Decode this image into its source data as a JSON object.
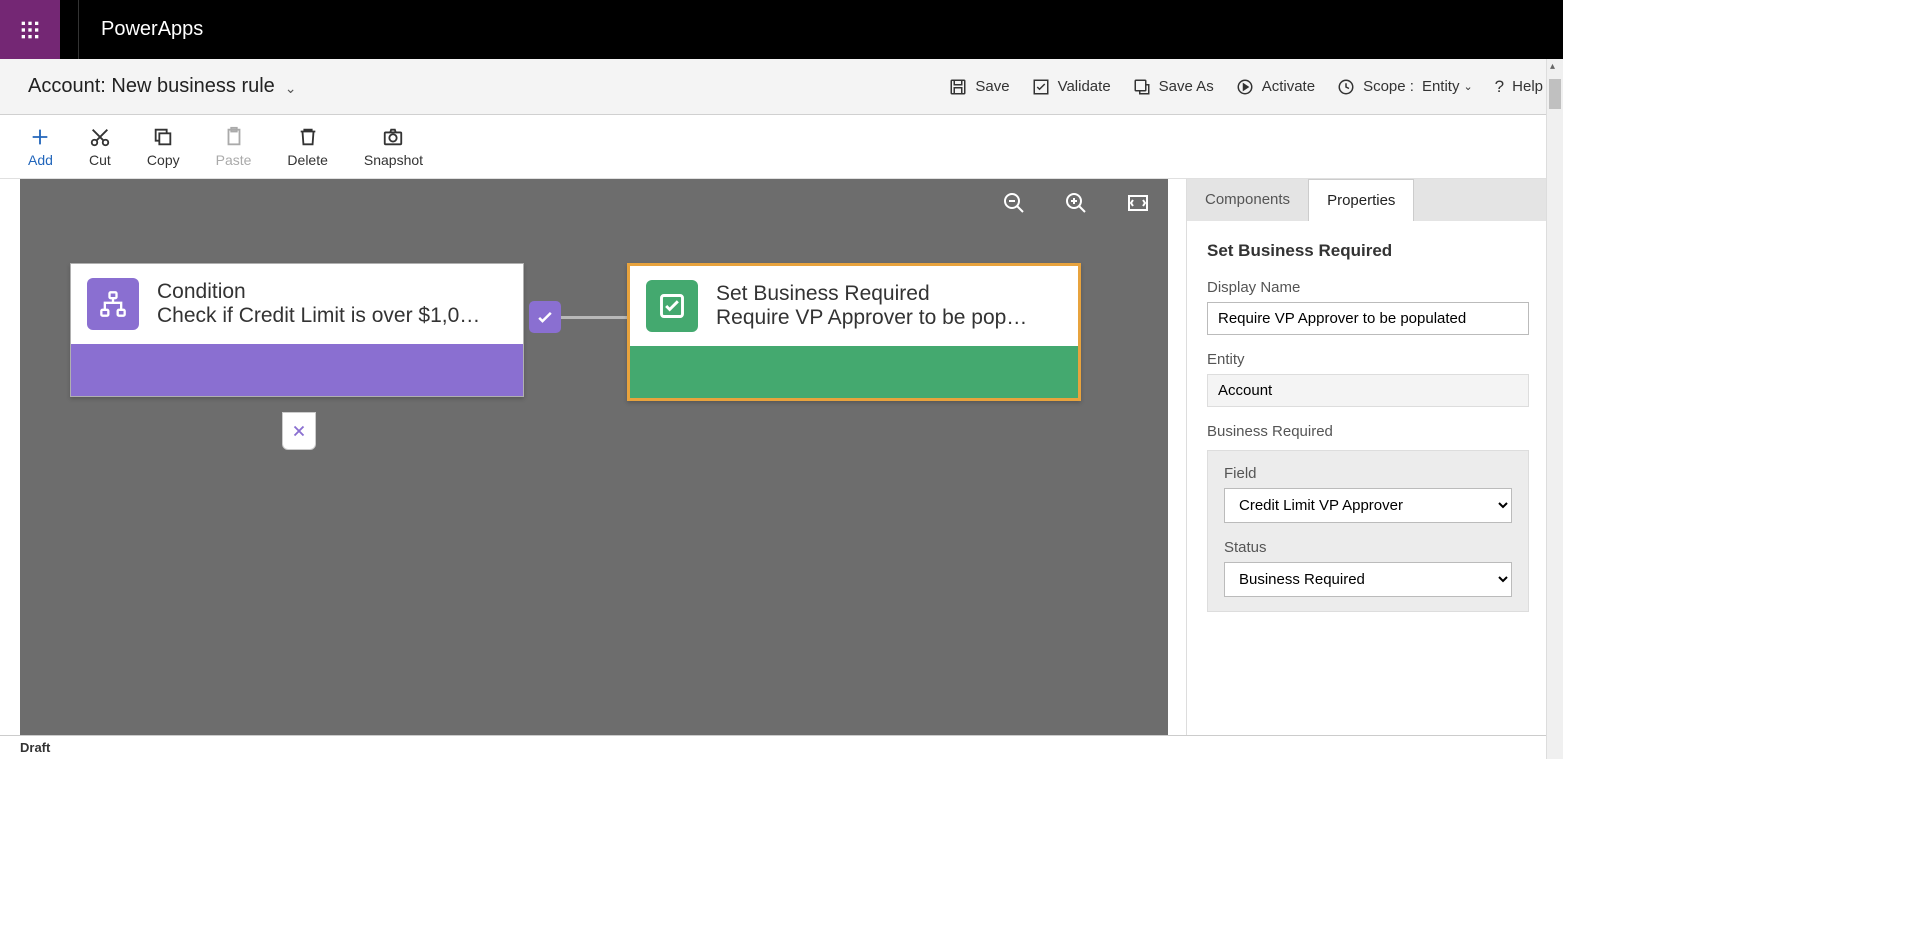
{
  "header": {
    "app_title": "PowerApps"
  },
  "subheader": {
    "rule_title": "Account: New business rule",
    "actions": {
      "save": "Save",
      "validate": "Validate",
      "save_as": "Save As",
      "activate": "Activate",
      "scope_label": "Scope :",
      "scope_value": "Entity",
      "help": "Help"
    }
  },
  "toolbar": {
    "add": "Add",
    "cut": "Cut",
    "copy": "Copy",
    "paste": "Paste",
    "delete": "Delete",
    "snapshot": "Snapshot"
  },
  "canvas": {
    "nodes": {
      "condition": {
        "title": "Condition",
        "subtitle": "Check if Credit Limit is over $1,0…"
      },
      "action": {
        "title": "Set Business Required",
        "subtitle": "Require VP Approver to be pop…"
      }
    }
  },
  "panel": {
    "tabs": {
      "components": "Components",
      "properties": "Properties"
    },
    "title": "Set Business Required",
    "display_name_label": "Display Name",
    "display_name_value": "Require VP Approver to be populated",
    "entity_label": "Entity",
    "entity_value": "Account",
    "section_label": "Business Required",
    "field_label": "Field",
    "field_value": "Credit Limit VP Approver",
    "status_label": "Status",
    "status_value": "Business Required"
  },
  "status_bar": "Draft"
}
